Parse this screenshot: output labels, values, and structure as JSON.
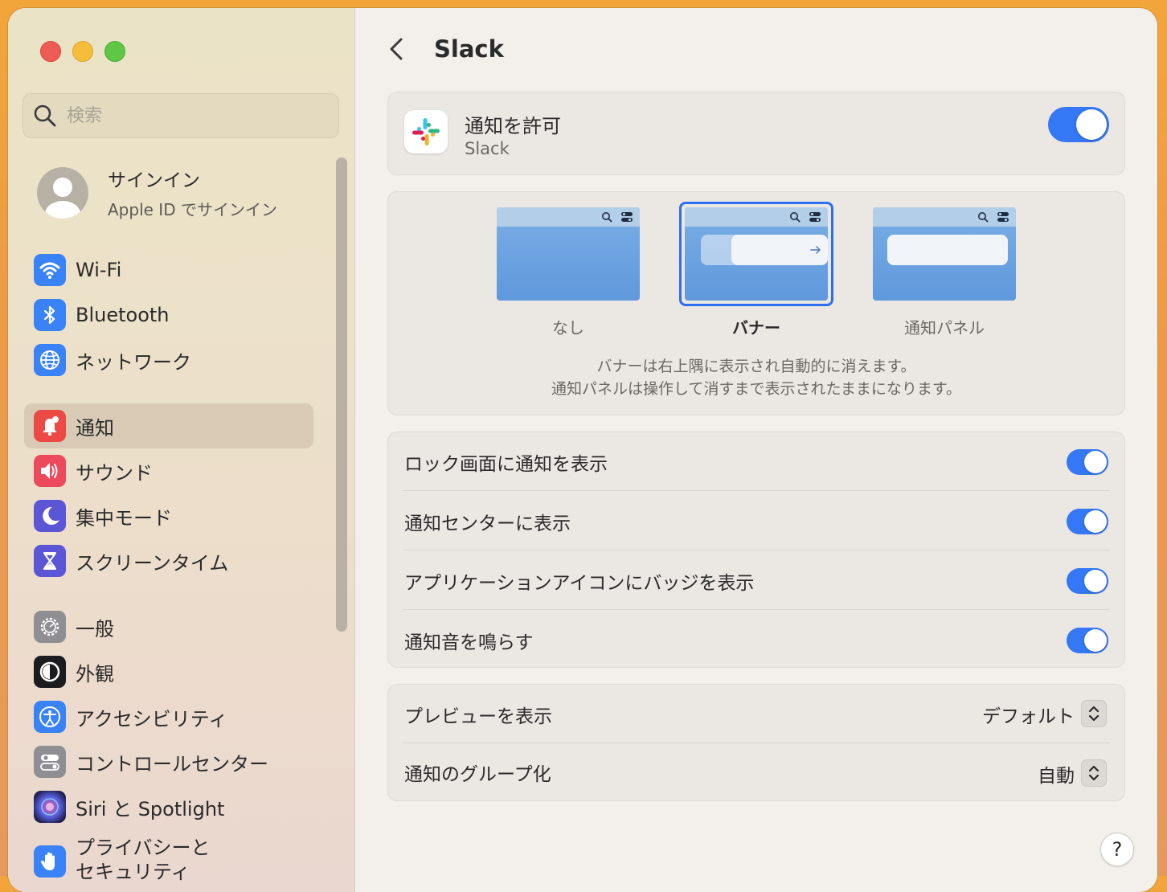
{
  "sidebar": {
    "search": {
      "placeholder": "検索"
    },
    "account": {
      "name": "サインイン",
      "subtitle": "Apple ID でサインイン"
    },
    "items": [
      {
        "label": "Wi-Fi",
        "icon": "wifi-icon",
        "color": "#3a82f7"
      },
      {
        "label": "Bluetooth",
        "icon": "bluetooth-icon",
        "color": "#3a82f7"
      },
      {
        "label": "ネットワーク",
        "icon": "globe-icon",
        "color": "#3a82f7"
      },
      {
        "label": "通知",
        "icon": "bell-icon",
        "color": "#ec4a45",
        "active": true
      },
      {
        "label": "サウンド",
        "icon": "speaker-icon",
        "color": "#ec4a5c"
      },
      {
        "label": "集中モード",
        "icon": "moon-icon",
        "color": "#5b56d6"
      },
      {
        "label": "スクリーンタイム",
        "icon": "hourglass-icon",
        "color": "#5b56d6"
      },
      {
        "label": "一般",
        "icon": "gear-icon",
        "color": "#8e8e93"
      },
      {
        "label": "外観",
        "icon": "appearance-icon",
        "color": "#1c1c1e"
      },
      {
        "label": "アクセシビリティ",
        "icon": "accessibility-icon",
        "color": "#3a82f7"
      },
      {
        "label": "コントロールセンター",
        "icon": "control-center-icon",
        "color": "#8e8e93"
      },
      {
        "label": "Siri と Spotlight",
        "icon": "siri-icon",
        "color": "#2b2d6e"
      },
      {
        "label": "プライバシーと\nセキュリティ",
        "icon": "hand-icon",
        "color": "#3a82f7"
      }
    ]
  },
  "main": {
    "title": "Slack",
    "allow": {
      "label": "通知を許可",
      "app_name": "Slack",
      "enabled": true
    },
    "alert_styles": {
      "options": [
        {
          "label": "なし",
          "selected": false
        },
        {
          "label": "バナー",
          "selected": true
        },
        {
          "label": "通知パネル",
          "selected": false
        }
      ],
      "description_line1": "バナーは右上隅に表示され自動的に消えます。",
      "description_line2": "通知パネルは操作して消すまで表示されたままになります。"
    },
    "toggles": [
      {
        "label": "ロック画面に通知を表示",
        "on": true
      },
      {
        "label": "通知センターに表示",
        "on": true
      },
      {
        "label": "アプリケーションアイコンにバッジを表示",
        "on": true
      },
      {
        "label": "通知音を鳴らす",
        "on": true
      }
    ],
    "popups": [
      {
        "label": "プレビューを表示",
        "value": "デフォルト"
      },
      {
        "label": "通知のグループ化",
        "value": "自動"
      }
    ],
    "help": "?"
  }
}
